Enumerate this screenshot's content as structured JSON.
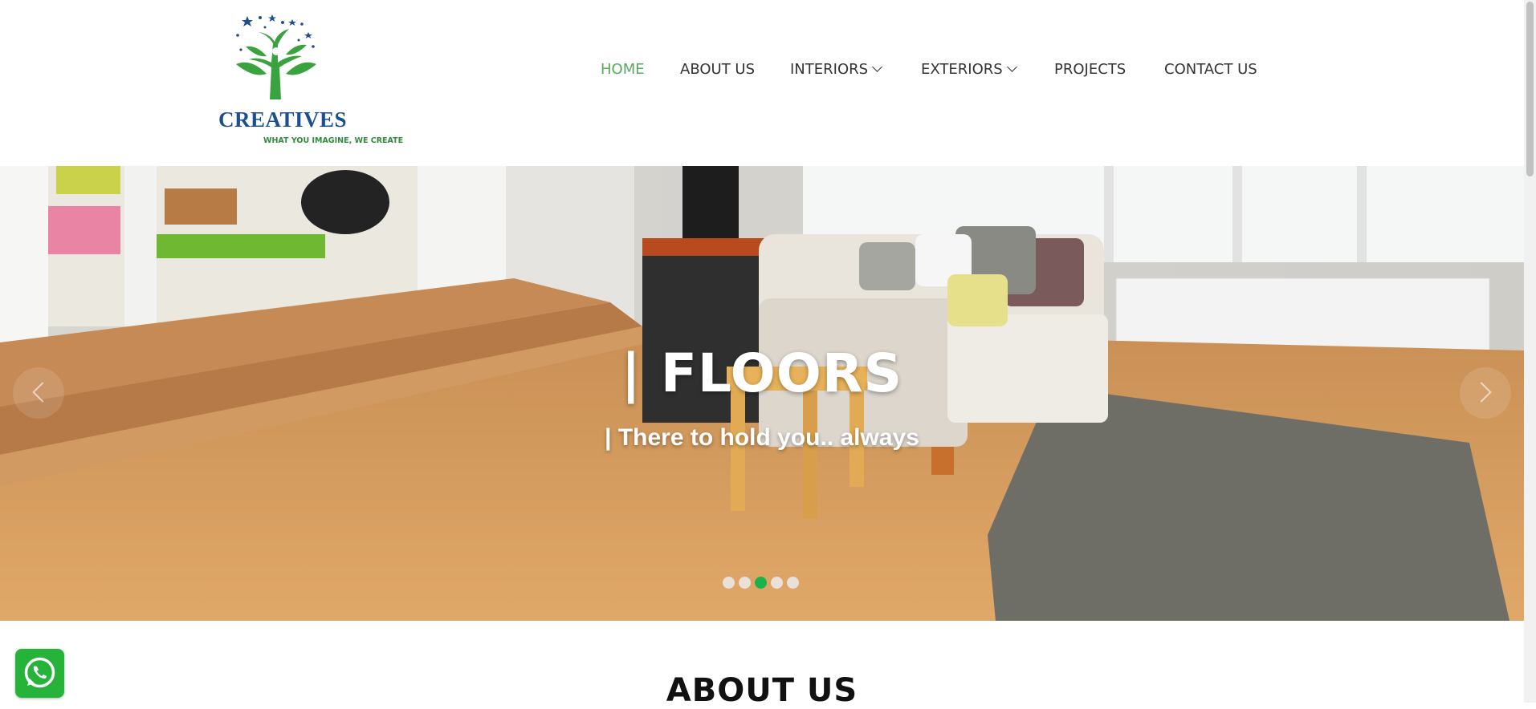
{
  "brand": {
    "name": "CREATIVES",
    "tagline": "WHAT YOU IMAGINE, WE CREATE",
    "colors": {
      "name": "#1d4f8f",
      "tree": "#3aa23f",
      "stars": "#1d4f8f"
    }
  },
  "nav": {
    "items": [
      {
        "label": "HOME",
        "active": true,
        "dropdown": false
      },
      {
        "label": "ABOUT US",
        "active": false,
        "dropdown": false
      },
      {
        "label": "INTERIORS",
        "active": false,
        "dropdown": true
      },
      {
        "label": "EXTERIORS",
        "active": false,
        "dropdown": true
      },
      {
        "label": "PROJECTS",
        "active": false,
        "dropdown": false
      },
      {
        "label": "CONTACT US",
        "active": false,
        "dropdown": false
      }
    ],
    "active_color": "#5aaa5e"
  },
  "hero": {
    "title": "| FLOORS",
    "subtitle": "| There to hold you.. always",
    "slide_count": 5,
    "active_slide": 3,
    "active_dot_color": "#19b24b"
  },
  "about": {
    "title": "ABOUT US"
  },
  "widgets": {
    "chat_icon": "whatsapp-icon",
    "chat_color": "#25b33a"
  }
}
